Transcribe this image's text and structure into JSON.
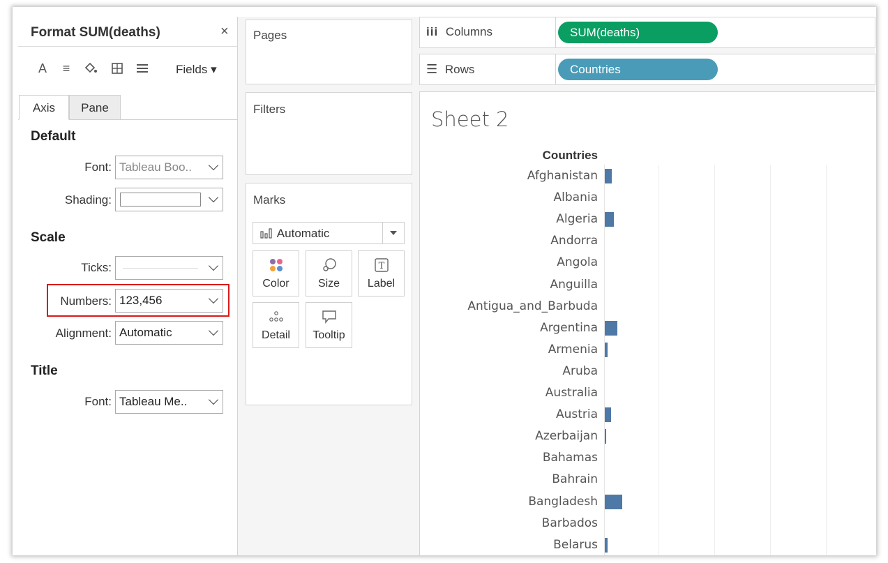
{
  "format_panel": {
    "title": "Format SUM(deaths)",
    "close": "×",
    "toolbar": {
      "icons": [
        "font-icon",
        "align-icon",
        "shading-icon",
        "borders-icon",
        "lines-icon"
      ],
      "fields_label": "Fields ▾"
    },
    "tabs": [
      {
        "label": "Axis",
        "active": true
      },
      {
        "label": "Pane",
        "active": false
      }
    ],
    "default_section": {
      "heading": "Default",
      "font_label": "Font:",
      "font_value": "Tableau Boo..",
      "shading_label": "Shading:"
    },
    "scale_section": {
      "heading": "Scale",
      "ticks_label": "Ticks:",
      "numbers_label": "Numbers:",
      "numbers_value": "123,456",
      "alignment_label": "Alignment:",
      "alignment_value": "Automatic"
    },
    "title_section": {
      "heading": "Title",
      "font_label": "Font:",
      "font_value": "Tableau Me.."
    },
    "highlight_color": "#d9191a"
  },
  "cards": {
    "pages": "Pages",
    "filters": "Filters",
    "marks": {
      "title": "Marks",
      "type_value": "Automatic",
      "buttons": [
        {
          "label": "Color",
          "icon": "color-dots-icon"
        },
        {
          "label": "Size",
          "icon": "size-icon"
        },
        {
          "label": "Label",
          "icon": "label-icon"
        },
        {
          "label": "Detail",
          "icon": "detail-icon"
        },
        {
          "label": "Tooltip",
          "icon": "tooltip-icon"
        }
      ]
    }
  },
  "shelves": {
    "columns": {
      "label": "Columns",
      "pill": "SUM(deaths)",
      "pill_color": "#0b9e62"
    },
    "rows": {
      "label": "Rows",
      "pill": "Countries",
      "pill_color": "#4a9bb8"
    }
  },
  "sheet": {
    "title": "Sheet 2",
    "column_header": "Countries"
  },
  "chart_data": {
    "type": "bar",
    "orientation": "horizontal",
    "title": "Sheet 2",
    "ylabel": "Countries",
    "bar_color": "#4e79a7",
    "categories": [
      "Afghanistan",
      "Albania",
      "Algeria",
      "Andorra",
      "Angola",
      "Anguilla",
      "Antigua_and_Barbuda",
      "Argentina",
      "Armenia",
      "Aruba",
      "Australia",
      "Austria",
      "Azerbaijan",
      "Bahamas",
      "Bahrain",
      "Bangladesh",
      "Barbados",
      "Belarus"
    ],
    "relative_values": [
      0.4,
      0,
      0.5,
      0,
      0,
      0,
      0,
      0.7,
      0.15,
      0,
      0,
      0.35,
      0.05,
      0,
      0,
      1.0,
      0,
      0.15
    ]
  }
}
